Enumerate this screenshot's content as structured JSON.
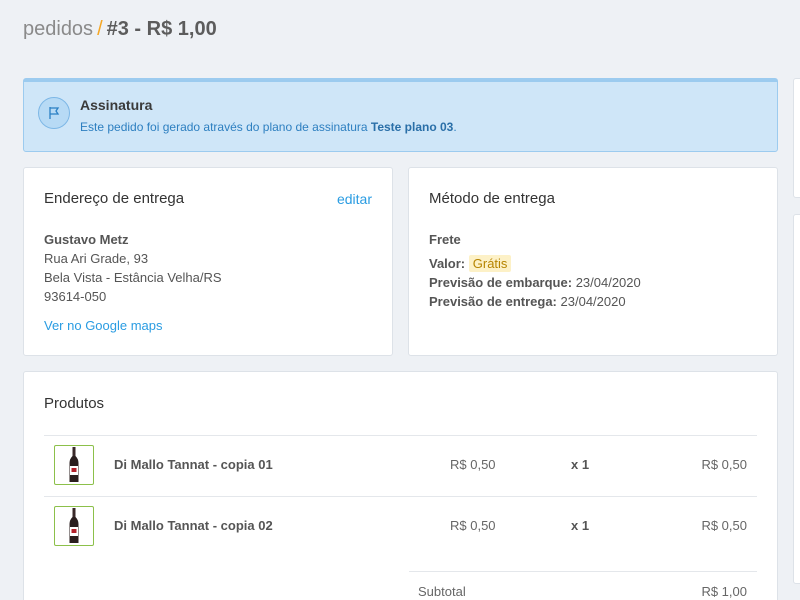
{
  "header": {
    "breadcrumb_root": "pedidos",
    "separator": "/",
    "order_label": "#3 - R$ 1,00"
  },
  "banner": {
    "title": "Assinatura",
    "text_prefix": "Este pedido foi gerado através do plano de assinatura ",
    "plan_name": "Teste plano 03",
    "text_suffix": ".",
    "icon": "flag-icon"
  },
  "shipping_address": {
    "title": "Endereço de entrega",
    "edit_label": "editar",
    "name": "Gustavo Metz",
    "street": "Rua Ari Grade, 93",
    "city": "Bela Vista - Estância Velha/RS",
    "zip": "93614-050",
    "maps_link": "Ver no Google maps"
  },
  "shipping_method": {
    "title": "Método de entrega",
    "method": "Frete",
    "value_label": "Valor:",
    "value": "Grátis",
    "ship_label": "Previsão de embarque:",
    "ship_date": "23/04/2020",
    "delivery_label": "Previsão de entrega:",
    "delivery_date": "23/04/2020"
  },
  "products": {
    "title": "Produtos",
    "items": [
      {
        "name": "Di Mallo Tannat - copia 01",
        "unit_price": "R$ 0,50",
        "qty": "x 1",
        "total": "R$ 0,50",
        "icon": "wine-bottle-icon"
      },
      {
        "name": "Di Mallo Tannat - copia 02",
        "unit_price": "R$ 0,50",
        "qty": "x 1",
        "total": "R$ 0,50",
        "icon": "wine-bottle-icon"
      }
    ],
    "subtotal_label": "Subtotal",
    "subtotal_value": "R$ 1,00"
  },
  "colors": {
    "accent_link": "#2a9ce2",
    "banner_bg": "#cfe6f8",
    "free_badge": "#fdf1c7",
    "title_slash": "#f5a623"
  }
}
